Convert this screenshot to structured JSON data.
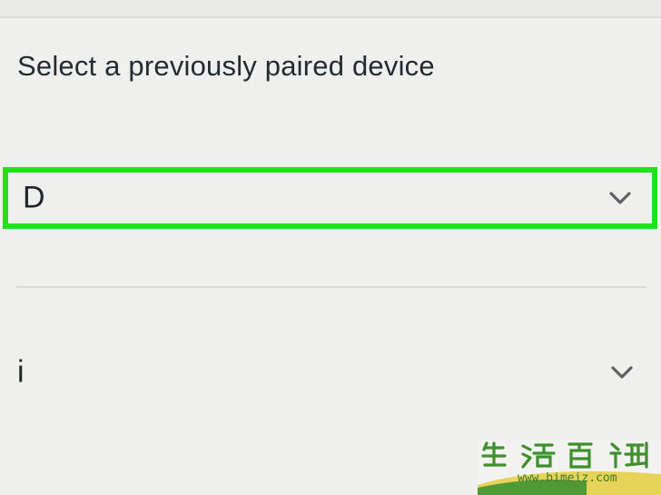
{
  "section": {
    "title": "Select a previously paired device"
  },
  "devices": [
    {
      "name": "D",
      "icon": "chevron-down-icon",
      "highlighted": true
    },
    {
      "name": "i",
      "icon": "chevron-down-icon",
      "highlighted": false
    }
  ],
  "watermark": {
    "url": "www.bimeiz.com"
  },
  "colors": {
    "background": "#eff0ed",
    "highlight": "#1fe21a",
    "text": "#232b33",
    "chevron": "#5d6167"
  }
}
